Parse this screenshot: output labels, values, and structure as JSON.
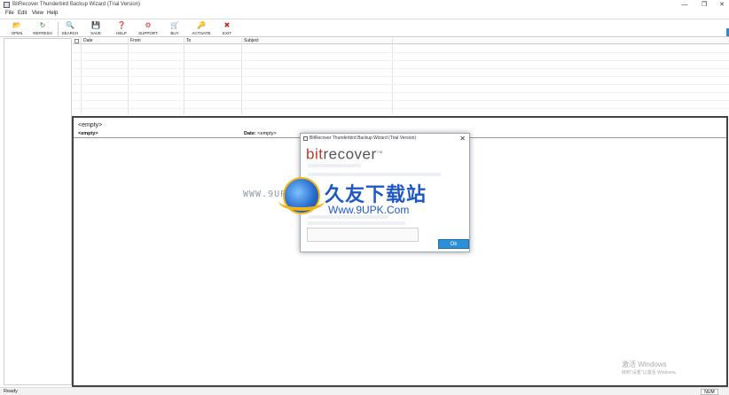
{
  "window": {
    "title": "BitRecover Thunderbird Backup Wizard (Trial Version)",
    "minimize": "—",
    "maximize": "❐",
    "close": "✕"
  },
  "menu": [
    "File",
    "Edit",
    "View",
    "Help"
  ],
  "toolbar": [
    {
      "label": "OPEN",
      "icon": "folder-icon",
      "glyph": "📂"
    },
    {
      "label": "REFRESH",
      "icon": "refresh-icon",
      "glyph": "↻"
    },
    {
      "label": "SEARCH",
      "icon": "search-icon",
      "glyph": "🔍"
    },
    {
      "label": "SAVE",
      "icon": "save-icon",
      "glyph": "💾"
    },
    {
      "label": "HELP",
      "icon": "help-icon",
      "glyph": "❓"
    },
    {
      "label": "SUPPORT",
      "icon": "support-icon",
      "glyph": "⚙"
    },
    {
      "label": "BUY",
      "icon": "cart-icon",
      "glyph": "🛒"
    },
    {
      "label": "ACTIVATE",
      "icon": "key-icon",
      "glyph": "🔑"
    },
    {
      "label": "EXIT",
      "icon": "exit-icon",
      "glyph": "✖"
    }
  ],
  "grid": {
    "columns": [
      "Date",
      "From",
      "To",
      "Subject"
    ]
  },
  "preview": {
    "subject": "<empty>",
    "from": "<empty>",
    "date_label": "Date:",
    "date_value": "<empty>"
  },
  "dialog": {
    "title": "BitRecover Thunderbird Backup Wizard (Trial Version)",
    "logo_prefix": "bit",
    "logo_suffix": "recover",
    "logo_tm": "TM",
    "ok_label": "Ok",
    "close": "✕"
  },
  "overlay_watermark": {
    "url_left": "WWW.9UPK.COM",
    "chinese": "久友下载站",
    "url": "Www.9UPK.Com"
  },
  "windows_activation": {
    "line1": "激活 Windows",
    "line2": "转到\"设置\"以激活 Windows。"
  },
  "status": {
    "text": "Ready",
    "num": "NUM"
  },
  "colors": {
    "accent": "#2d8fd5",
    "logo_red": "#c0392b",
    "watermark_blue": "#1f59c8"
  }
}
